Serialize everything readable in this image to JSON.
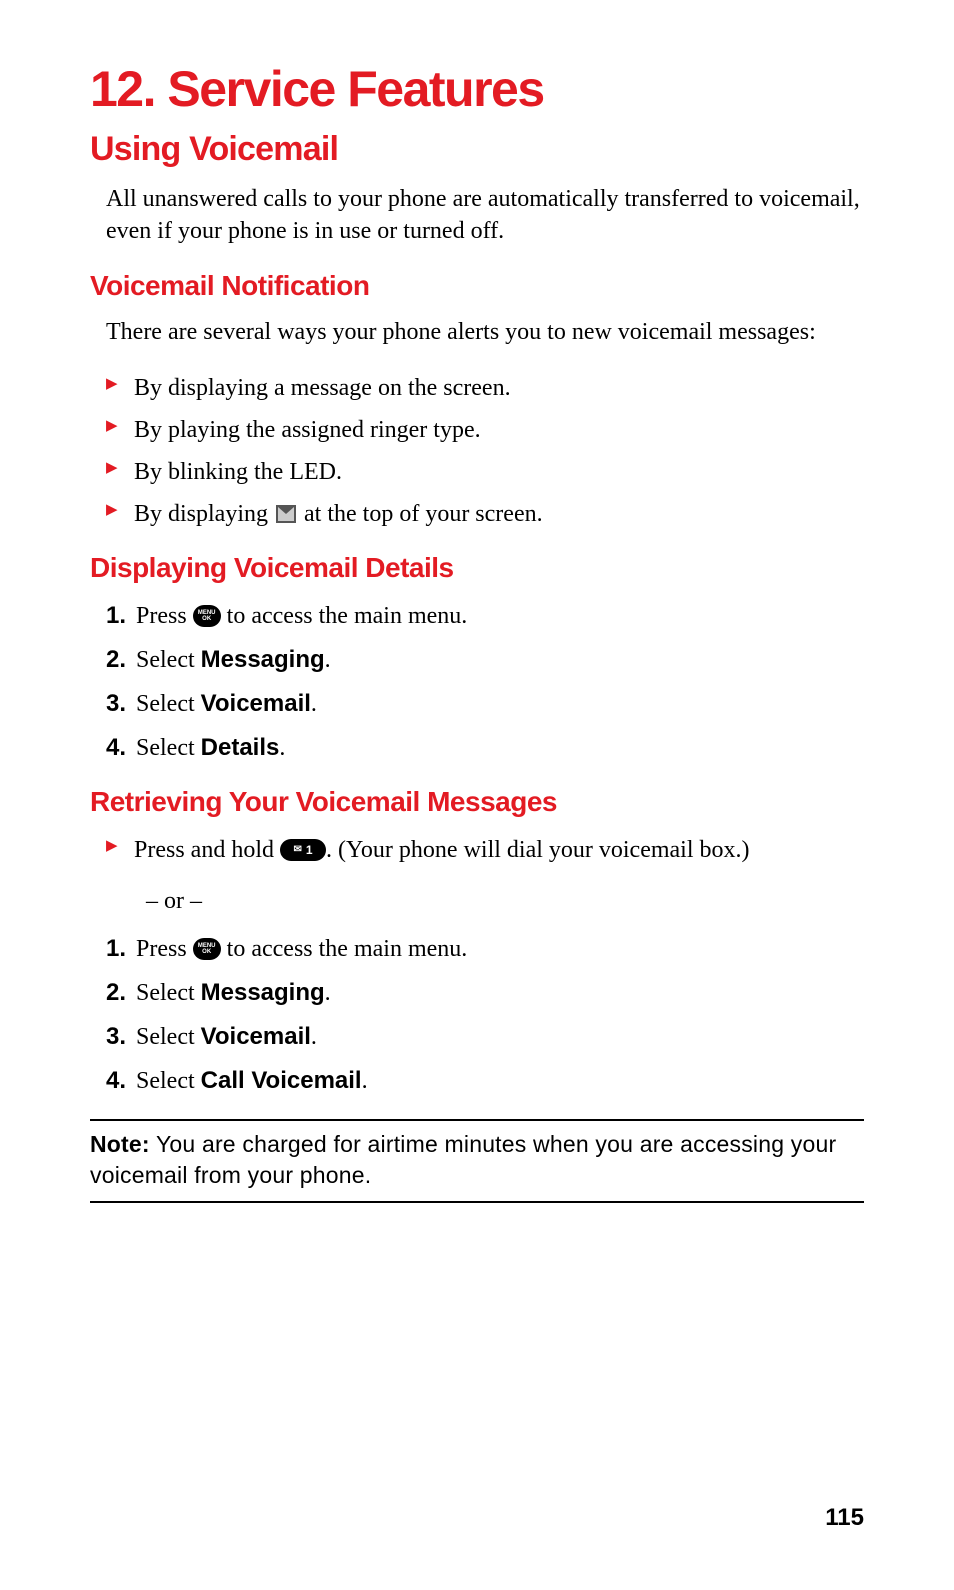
{
  "chapter": {
    "title": "12. Service Features"
  },
  "section": {
    "title": "Using Voicemail",
    "intro": "All unanswered calls to your phone are automatically transferred to voicemail, even if your phone is in use or turned off."
  },
  "sub1": {
    "title": "Voicemail Notification",
    "intro": "There are several ways your phone alerts you to new voicemail messages:",
    "bullets": {
      "b1": "By displaying a message on the screen.",
      "b2": "By playing the assigned ringer type.",
      "b3": "By blinking the LED.",
      "b4_pre": "By displaying ",
      "b4_post": " at the top of your screen."
    }
  },
  "sub2": {
    "title": "Displaying Voicemail Details",
    "steps": {
      "s1_pre": "Press ",
      "s1_post": " to access the main menu.",
      "s2_pre": "Select ",
      "s2_bold": "Messaging",
      "s2_post": ".",
      "s3_pre": "Select ",
      "s3_bold": "Voicemail",
      "s3_post": ".",
      "s4_pre": "Select ",
      "s4_bold": "Details",
      "s4_post": "."
    }
  },
  "sub3": {
    "title": "Retrieving Your Voicemail Messages",
    "bullet_pre": "Press and hold ",
    "bullet_post": ". (Your phone will dial your voicemail box.)",
    "or": "– or –",
    "steps": {
      "s1_pre": "Press ",
      "s1_post": " to access the main menu.",
      "s2_pre": "Select ",
      "s2_bold": "Messaging",
      "s2_post": ".",
      "s3_pre": "Select ",
      "s3_bold": "Voicemail",
      "s3_post": ".",
      "s4_pre": "Select ",
      "s4_bold": "Call Voicemail",
      "s4_post": "."
    }
  },
  "note": {
    "label": "Note:",
    "text": " You are charged for airtime minutes when you are accessing your voicemail from your phone."
  },
  "nums": {
    "n1": "1.",
    "n2": "2.",
    "n3": "3.",
    "n4": "4."
  },
  "icons": {
    "menu_top": "MENU",
    "menu_bot": "OK",
    "key1_env": "✉",
    "key1_num": "1"
  },
  "pageNumber": "115"
}
